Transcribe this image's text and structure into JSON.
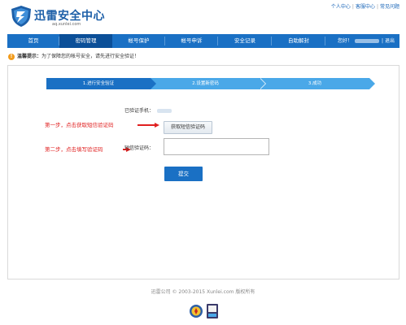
{
  "header": {
    "logo_title": "迅雷安全中心",
    "logo_url": "aq.xunlei.com",
    "top_links": [
      "个人中心",
      "客服中心",
      "常见问题"
    ]
  },
  "nav": {
    "items": [
      "首页",
      "密码管理",
      "帐号保护",
      "帐号申诉",
      "安全记录",
      "自助解封"
    ],
    "active_index": 1,
    "user_greeting": "您好！",
    "logout": "退出"
  },
  "notice": {
    "prefix": "温馨提示：",
    "text": "为了保障您的帐号安全，请先进行安全验证！"
  },
  "steps": [
    "1.进行安全验证",
    "2.设置新密码",
    "3.成功"
  ],
  "form": {
    "phone_label": "已验证手机：",
    "get_code_button": "获取短信验证码",
    "code_label": "短信验证码：",
    "code_value": "",
    "submit_button": "提交"
  },
  "annotations": {
    "step_one": "第一步，点击获取短信验证码",
    "step_two": "第二步，点击填写验证码"
  },
  "footer": {
    "copyright": "迅雷公司 © 2003-2015 Xunlei.com 版权所有"
  },
  "colors": {
    "nav_blue": "#1a70c4",
    "nav_active": "#0b4f98",
    "step_light": "#4aa8e8",
    "annotation_red": "#e02020",
    "warning_orange": "#f29b1c"
  }
}
